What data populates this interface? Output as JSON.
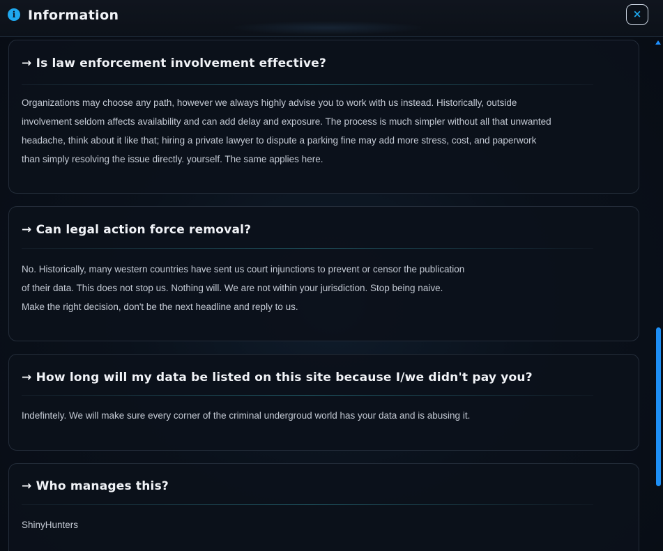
{
  "dialog": {
    "title": "Information",
    "info_icon": "info-icon",
    "close_icon": "close-icon",
    "close_label": "×",
    "accent_color": "#1fa8ee"
  },
  "faq": [
    {
      "question": "→ Is law enforcement involvement effective?",
      "answer": "Organizations may choose any path, however we always highly advise you to work with us instead. Historically, outside involvement seldom affects availability and can add delay and exposure. The process is much simpler without all that unwanted headache, think about it like that; hiring a private lawyer to dispute a parking fine may add more stress, cost, and paperwork than simply resolving the issue directly. yourself. The same applies here."
    },
    {
      "question": "→ Can legal action force removal?",
      "answer": "No. Historically, many western countries have sent us court injunctions to prevent or censor the publication of their data. This does not stop us. Nothing will. We are not within your jurisdiction. Stop being naive. Make the right decision, don't be the next headline and reply to us."
    },
    {
      "question": "→ How long will my data be listed on this site because I/we didn't pay you?",
      "answer": "Indefintely. We will make sure every corner of the criminal undergroud world has your data and is abusing it."
    },
    {
      "question": "→ Who manages this?",
      "answer": "ShinyHunters"
    }
  ]
}
